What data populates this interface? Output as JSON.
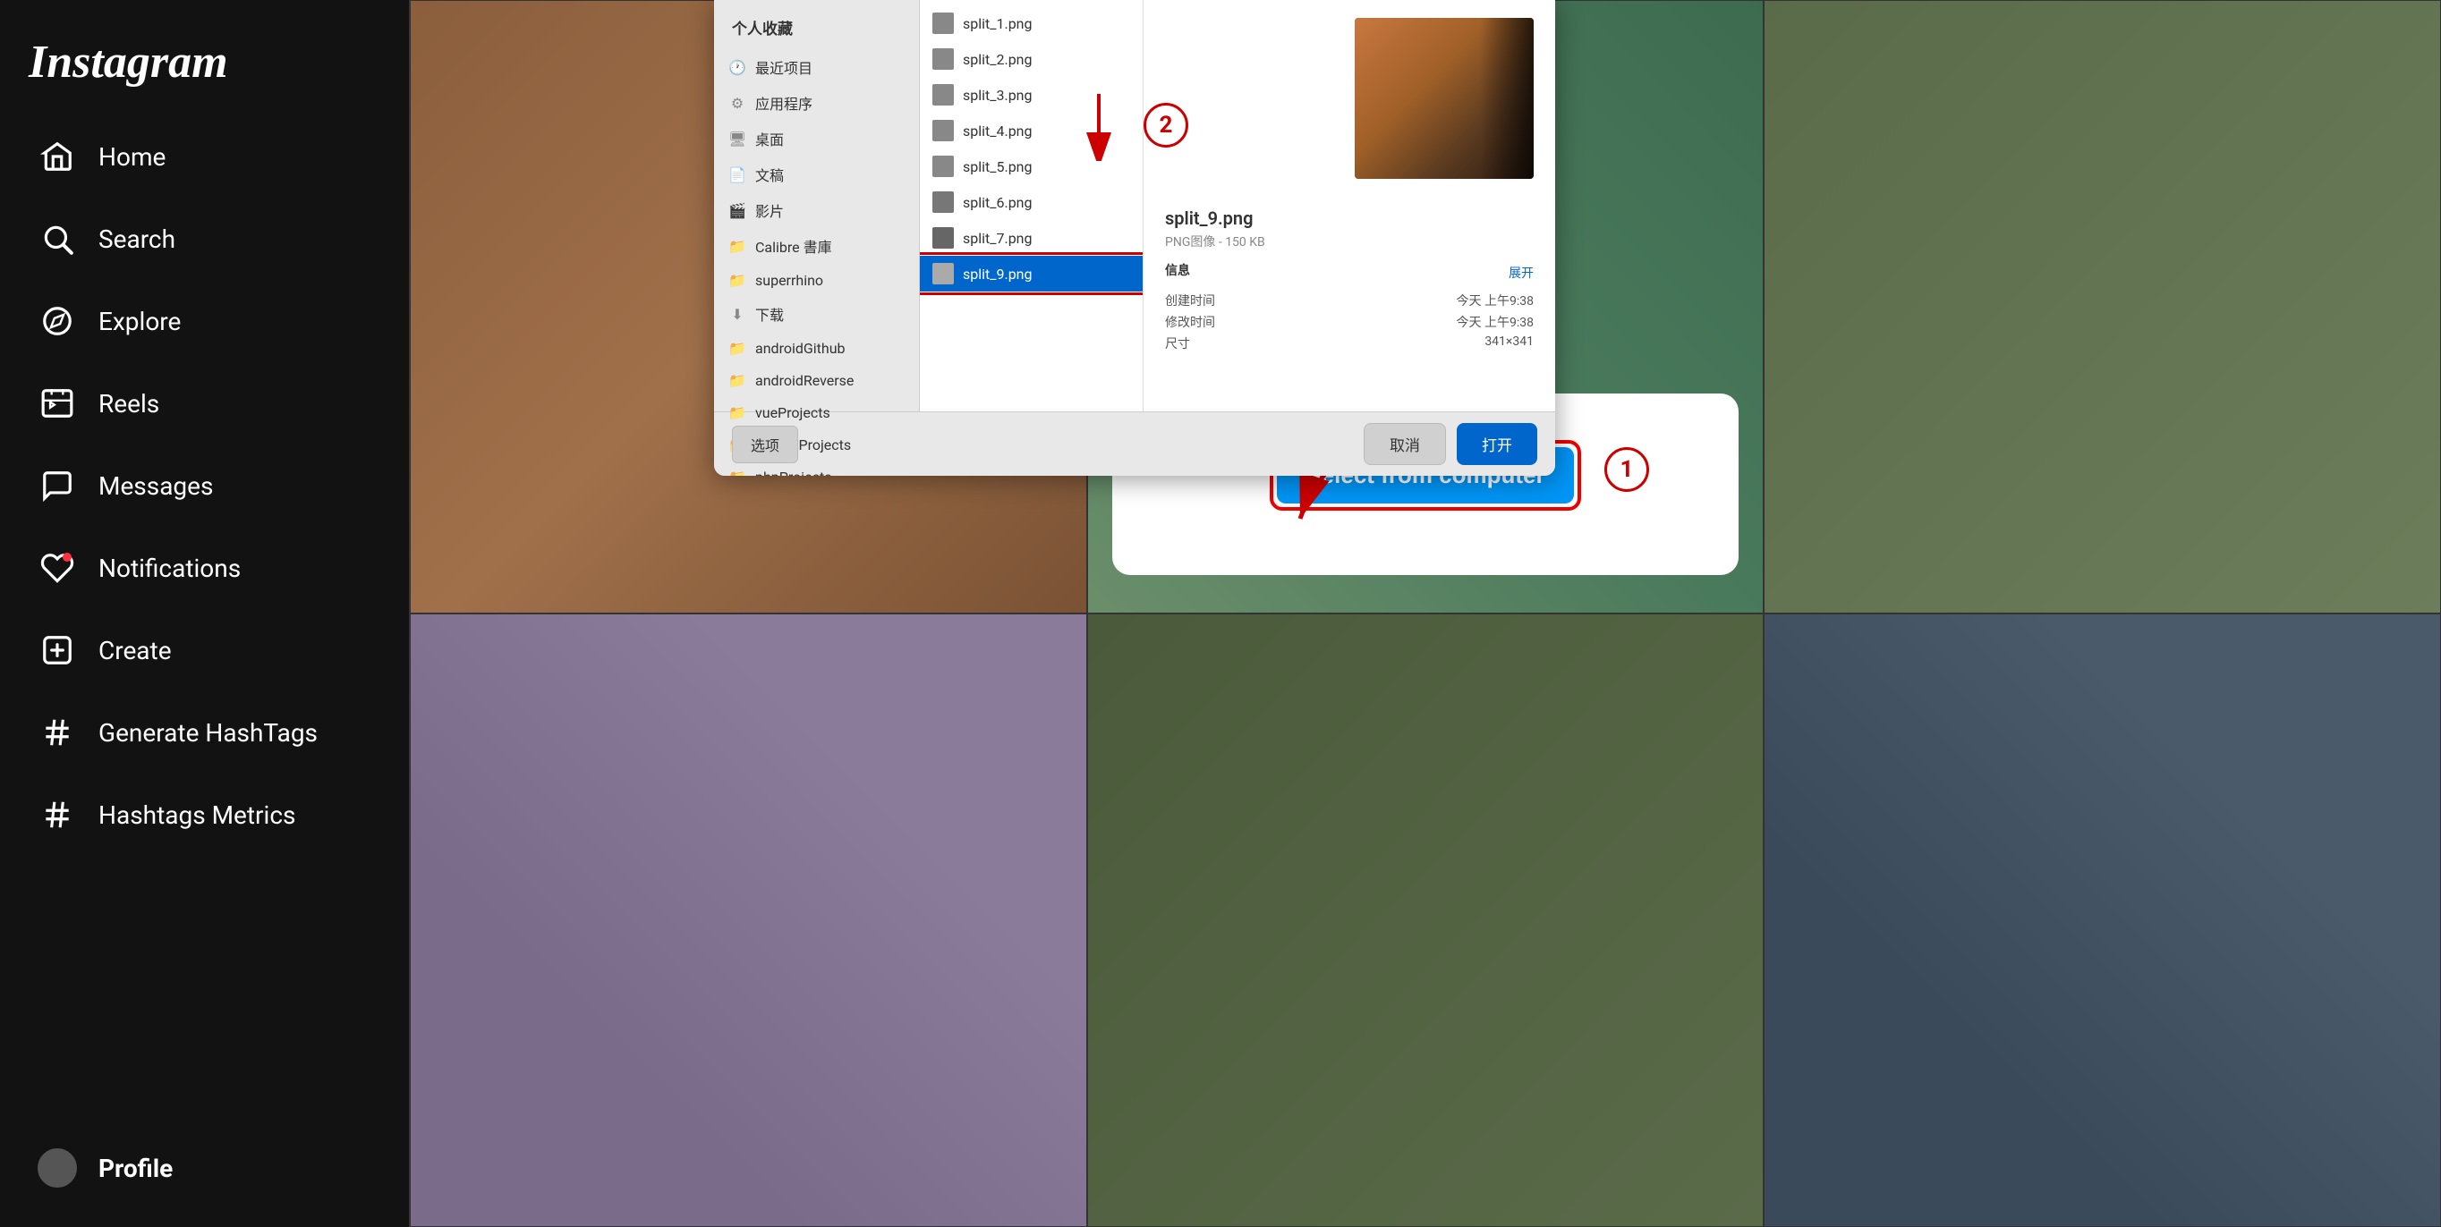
{
  "app": {
    "name": "Instagram"
  },
  "sidebar": {
    "logo": "Instagram",
    "nav_items": [
      {
        "id": "home",
        "label": "Home",
        "icon": "home"
      },
      {
        "id": "search",
        "label": "Search",
        "icon": "search"
      },
      {
        "id": "explore",
        "label": "Explore",
        "icon": "compass"
      },
      {
        "id": "reels",
        "label": "Reels",
        "icon": "play"
      },
      {
        "id": "messages",
        "label": "Messages",
        "icon": "message"
      },
      {
        "id": "notifications",
        "label": "Notifications",
        "icon": "heart"
      },
      {
        "id": "create",
        "label": "Create",
        "icon": "plus-square"
      },
      {
        "id": "hashtags",
        "label": "Generate HashTags",
        "icon": "hash"
      },
      {
        "id": "metrics",
        "label": "Hashtags Metrics",
        "icon": "hash"
      }
    ],
    "profile": {
      "label": "Profile",
      "username": "profile"
    }
  },
  "file_picker": {
    "title": "个人收藏",
    "sidebar_items": [
      {
        "label": "最近项目",
        "icon": "clock"
      },
      {
        "label": "应用程序",
        "icon": "apps"
      },
      {
        "label": "桌面",
        "icon": "desktop"
      },
      {
        "label": "文稿",
        "icon": "doc"
      },
      {
        "label": "影片",
        "icon": "film"
      },
      {
        "label": "Calibre 書庫",
        "icon": "folder"
      },
      {
        "label": "superrhino",
        "icon": "folder"
      },
      {
        "label": "下载",
        "icon": "download"
      },
      {
        "label": "androidGithub",
        "icon": "folder"
      },
      {
        "label": "androidReverse",
        "icon": "folder"
      },
      {
        "label": "vueProjects",
        "icon": "folder"
      },
      {
        "label": "pythonProjects",
        "icon": "folder"
      },
      {
        "label": "phpProjects",
        "icon": "folder"
      }
    ],
    "files": [
      {
        "name": "split_1.png",
        "selected": false
      },
      {
        "name": "split_2.png",
        "selected": false
      },
      {
        "name": "split_3.png",
        "selected": false
      },
      {
        "name": "split_4.png",
        "selected": false
      },
      {
        "name": "split_5.png",
        "selected": false
      },
      {
        "name": "split_6.png",
        "selected": false
      },
      {
        "name": "split_7.png",
        "selected": false
      },
      {
        "name": "split_9.png",
        "selected": true
      }
    ],
    "selected_file": {
      "name": "split_9.png",
      "type": "PNG图像",
      "size": "150 KB",
      "info_label": "信息",
      "expand_label": "展开",
      "created_label": "创建时间",
      "created_value": "今天 上午9:38",
      "modified_label": "修改时间",
      "modified_value": "今天 上午9:38",
      "dimensions_label": "尺寸",
      "dimensions_value": "341×341"
    },
    "toolbar": {
      "options_label": "选项",
      "cancel_label": "取消",
      "open_label": "打开"
    }
  },
  "upload_modal": {
    "select_btn_label": "Select from computer"
  },
  "annotations": {
    "badge_1": "1",
    "badge_2": "2"
  }
}
